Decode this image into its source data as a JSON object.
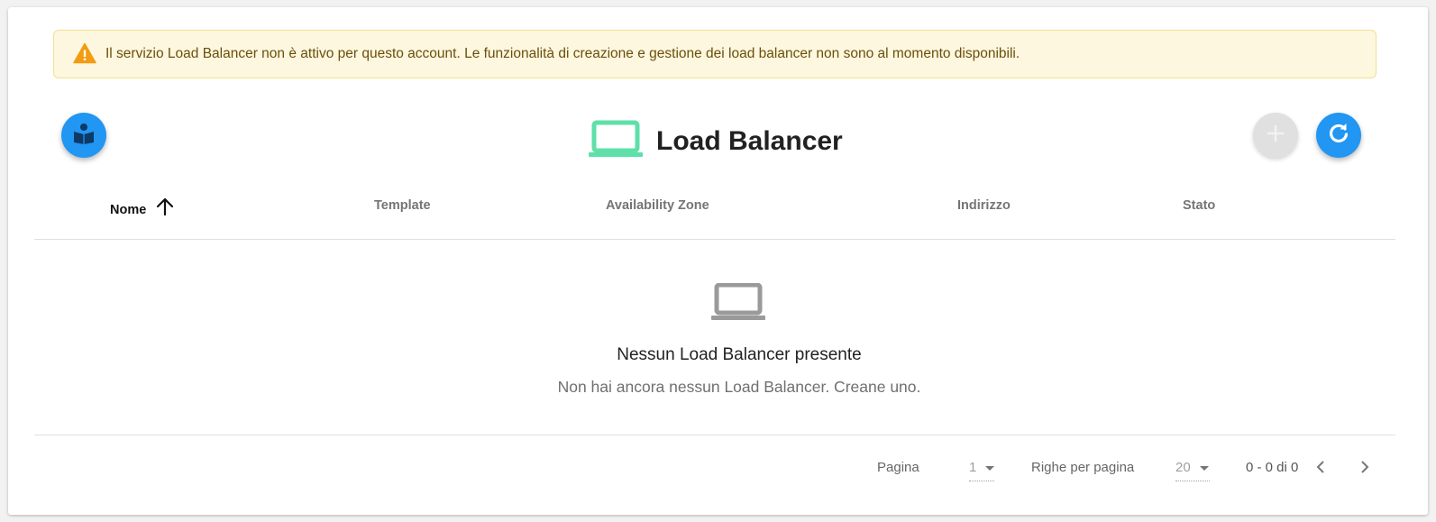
{
  "alert": {
    "message": "Il servizio Load Balancer non è attivo per questo account. Le funzionalità di creazione e gestione dei load balancer non sono al momento disponibili.",
    "icon": "warning-icon",
    "color": "#f39c12"
  },
  "header": {
    "title": "Load Balancer",
    "title_icon": "laptop-icon",
    "title_icon_color": "#5ee0a8",
    "docs_button_icon": "book-reader-icon",
    "add_button_icon": "plus-icon",
    "add_button_disabled": true,
    "refresh_button_icon": "refresh-icon",
    "accent": "#2196f3"
  },
  "table": {
    "columns": [
      {
        "label": "Nome",
        "sorted": "asc"
      },
      {
        "label": "Template"
      },
      {
        "label": "Availability Zone"
      },
      {
        "label": "Indirizzo"
      },
      {
        "label": "Stato"
      }
    ],
    "sort_icon": "arrow-up-icon"
  },
  "empty": {
    "icon": "laptop-icon",
    "title": "Nessun Load Balancer presente",
    "subtitle": "Non hai ancora nessun Load Balancer. Creane uno."
  },
  "pagination": {
    "page_label": "Pagina",
    "page_value": "1",
    "rows_label": "Righe per pagina",
    "rows_value": "20",
    "range": "0 - 0 di 0",
    "prev_icon": "chevron-left-icon",
    "next_icon": "chevron-right-icon"
  }
}
